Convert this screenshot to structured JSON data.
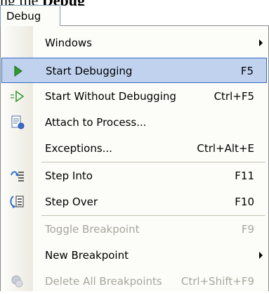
{
  "top_text": {
    "prefix": "ng the ",
    "bold": "Debug"
  },
  "menu": {
    "title": "Debug"
  },
  "items": [
    {
      "label": "Windows",
      "shortcut": "",
      "submenu": true,
      "icon": ""
    },
    {
      "label": "Start Debugging",
      "shortcut": "F5",
      "icon": "play-icon",
      "highlighted": true
    },
    {
      "label": "Start Without Debugging",
      "shortcut": "Ctrl+F5",
      "icon": "play-outline-icon"
    },
    {
      "label": "Attach to Process...",
      "shortcut": "",
      "icon": "attach-process-icon"
    },
    {
      "label": "Exceptions...",
      "shortcut": "Ctrl+Alt+E",
      "icon": ""
    },
    {
      "label": "Step Into",
      "shortcut": "F11",
      "icon": "step-into-icon"
    },
    {
      "label": "Step Over",
      "shortcut": "F10",
      "icon": "step-over-icon"
    },
    {
      "label": "Toggle Breakpoint",
      "shortcut": "F9",
      "icon": "",
      "disabled": true
    },
    {
      "label": "New Breakpoint",
      "shortcut": "",
      "submenu": true,
      "icon": ""
    },
    {
      "label": "Delete All Breakpoints",
      "shortcut": "Ctrl+Shift+F9",
      "icon": "delete-breakpoints-icon",
      "disabled": true
    }
  ],
  "colors": {
    "highlight": "#c1d2ee",
    "highlight_border": "#316ac5",
    "disabled_text": "#a7a69c"
  }
}
